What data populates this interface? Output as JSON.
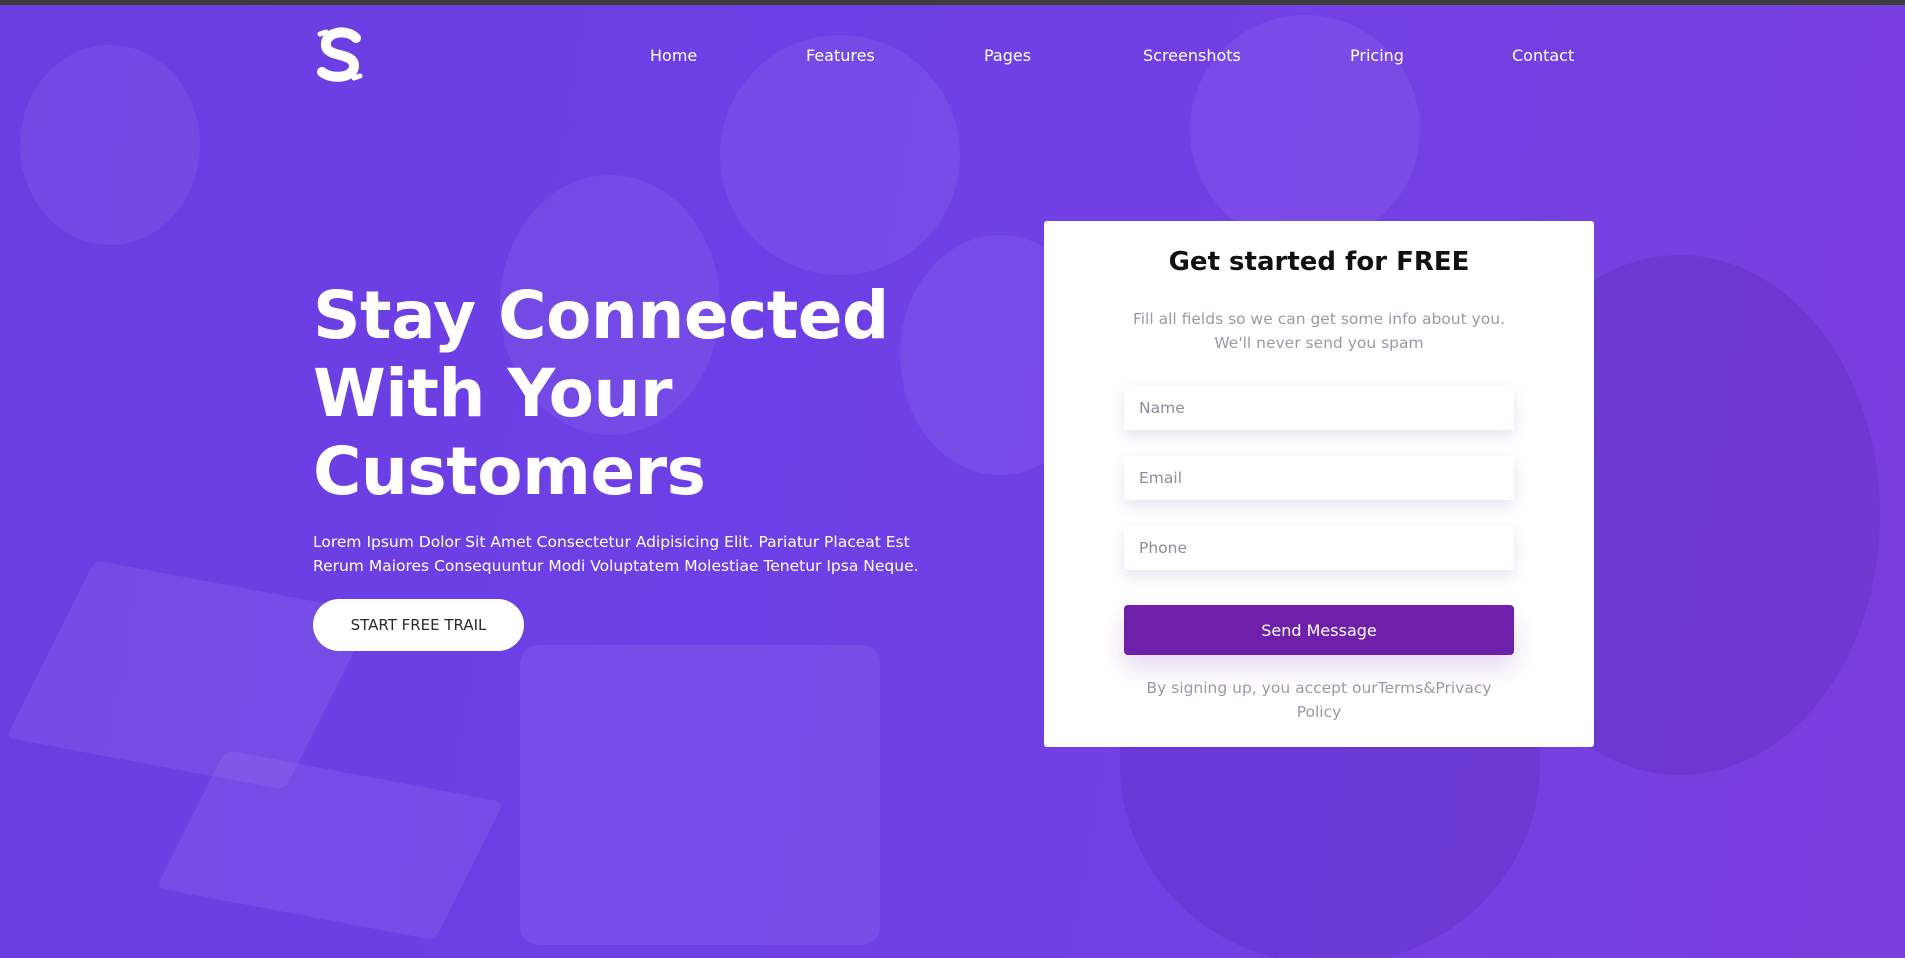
{
  "logo": {
    "letter": "S",
    "alt": "S"
  },
  "nav": {
    "items": [
      {
        "label": "Home"
      },
      {
        "label": "Features"
      },
      {
        "label": "Pages"
      },
      {
        "label": "Screenshots"
      },
      {
        "label": "Pricing"
      },
      {
        "label": "Contact"
      }
    ]
  },
  "hero": {
    "headline_line1": "Stay Connected",
    "headline_line2": "With Your",
    "headline_line3": "Customers",
    "description_line1": "Lorem Ipsum Dolor Sit Amet Consectetur Adipisicing Elit. Pariatur Placeat Est",
    "description_line2": "Rerum Maiores Consequuntur Modi Voluptatem Molestiae Tenetur Ipsa Neque.",
    "cta_label": "START FREE TRAIL"
  },
  "signup": {
    "title": "Get started for FREE",
    "desc_line1": "Fill all fields so we can get some info about you.",
    "desc_line2": "We'll never send you spam",
    "name_placeholder": "Name",
    "email_placeholder": "Email",
    "phone_placeholder": "Phone",
    "submit_label": "Send Message",
    "terms_prefix": "By signing up, you accept our",
    "terms_link": "Terms&Privacy Policy"
  },
  "colors": {
    "hero_bg": "#6c40e6",
    "button_primary": "#6f20aa",
    "text_muted": "#9a9aa6"
  }
}
